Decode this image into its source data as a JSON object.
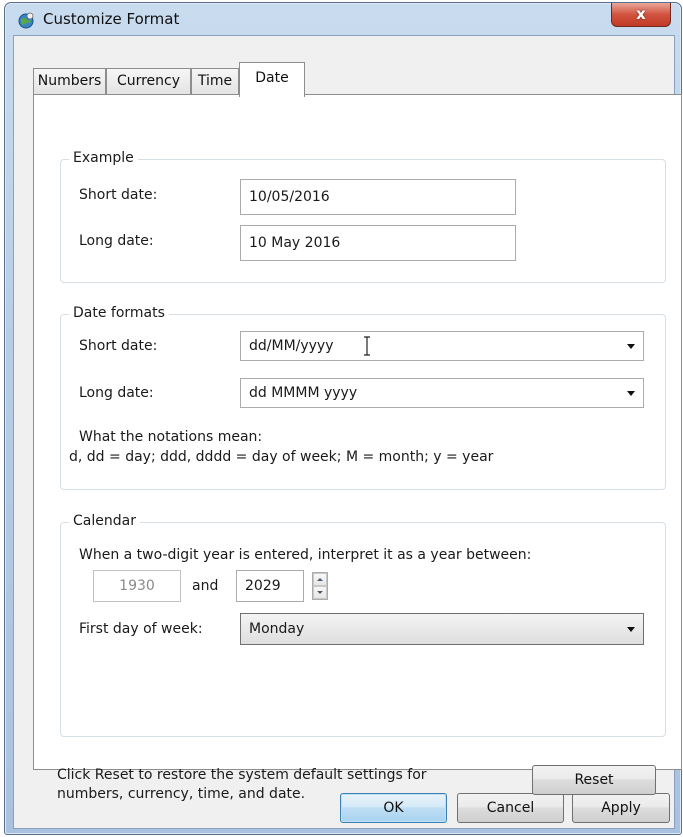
{
  "window": {
    "title": "Customize Format",
    "close_label": "x"
  },
  "tabs": [
    {
      "label": "Numbers"
    },
    {
      "label": "Currency"
    },
    {
      "label": "Time"
    },
    {
      "label": "Date"
    }
  ],
  "example": {
    "group_title": "Example",
    "short_label": "Short date:",
    "short_value": "10/05/2016",
    "long_label": "Long date:",
    "long_value": "10 May 2016"
  },
  "date_formats": {
    "group_title": "Date formats",
    "short_label": "Short date:",
    "short_value": "dd/MM/yyyy",
    "long_label": "Long date:",
    "long_value": "dd MMMM yyyy",
    "notation_title": "What the notations mean:",
    "notation_text": "d, dd = day;  ddd, dddd = day of week;  M = month;  y = year"
  },
  "calendar": {
    "group_title": "Calendar",
    "interpret_text": "When a two-digit year is entered, interpret it as a year between:",
    "year_start": "1930",
    "and_label": "and",
    "year_end": "2029",
    "first_day_label": "First day of week:",
    "first_day_value": "Monday"
  },
  "reset_note": {
    "line1": "Click Reset to restore the system default settings for",
    "line2": "numbers, currency, time, and date."
  },
  "buttons": {
    "reset": "Reset",
    "ok": "OK",
    "cancel": "Cancel",
    "apply": "Apply"
  }
}
